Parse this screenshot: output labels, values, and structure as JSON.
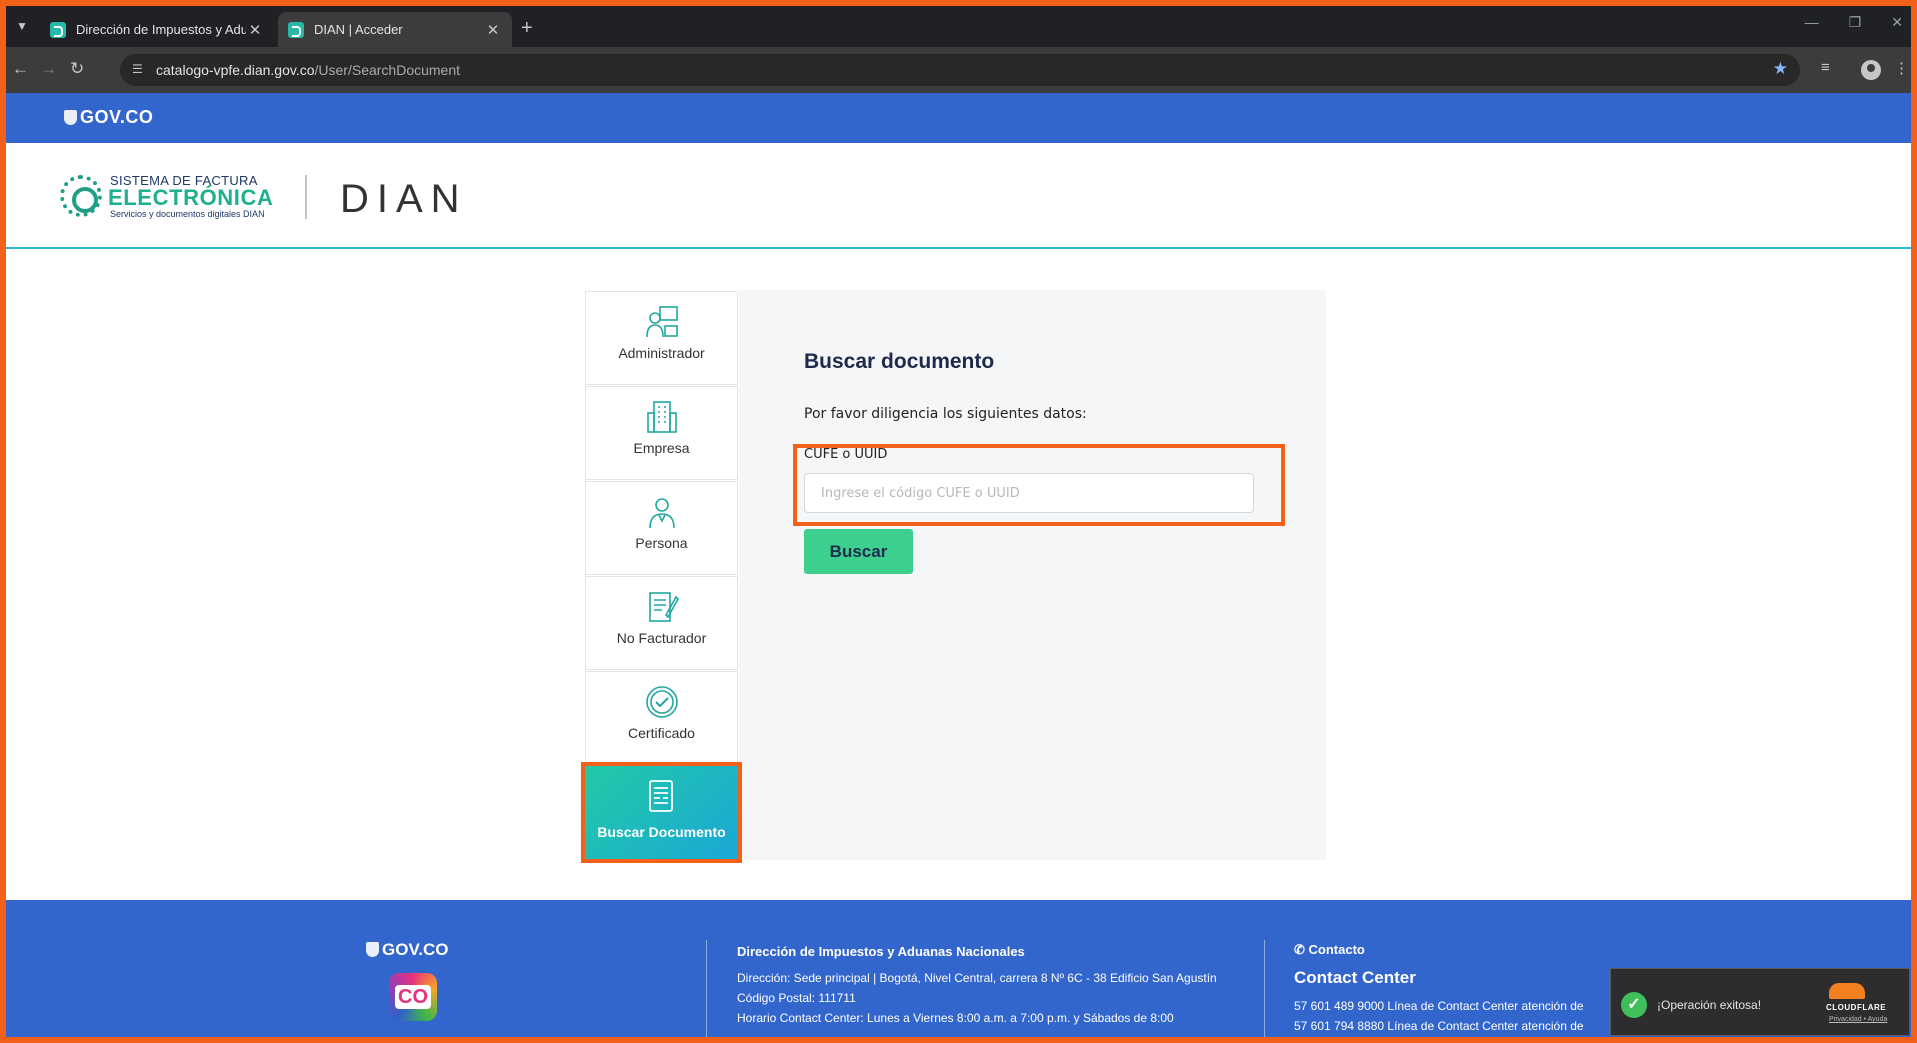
{
  "browser": {
    "tabs": [
      {
        "title": "Dirección de Impuestos y Adua",
        "active": false
      },
      {
        "title": "DIAN | Acceder",
        "active": true
      }
    ],
    "new_tab_icon": "plus",
    "url_host": "catalogo-vpfe.dian.gov.co",
    "url_path": "/User/SearchDocument"
  },
  "gov_bar": {
    "logo": "GOV.CO"
  },
  "brand": {
    "sfe_line1": "SISTEMA DE FACTURA",
    "sfe_line2": "ELECTRÓNICA",
    "sfe_line3": "Servicios y documentos digitales DIAN",
    "dian": "DIAN"
  },
  "menu": [
    {
      "label": "Administrador",
      "icon": "admin-icon"
    },
    {
      "label": "Empresa",
      "icon": "building-icon"
    },
    {
      "label": "Persona",
      "icon": "person-icon"
    },
    {
      "label": "No Facturador",
      "icon": "document-edit-icon"
    },
    {
      "label": "Certificado",
      "icon": "certificate-icon"
    },
    {
      "label": "Buscar Documento",
      "icon": "document-search-icon",
      "active": true
    }
  ],
  "form": {
    "title": "Buscar documento",
    "instructions": "Por favor diligencia los siguientes datos:",
    "field_label": "CUFE o UUID",
    "placeholder": "Ingrese el código CUFE o UUID",
    "value": "",
    "button": "Buscar"
  },
  "footer": {
    "gov": "GOV.CO",
    "co_badge": "CO",
    "entity": "Dirección de Impuestos y Aduanas Nacionales",
    "address": "Dirección: Sede principal | Bogotá, Nivel Central, carrera 8 Nº 6C - 38 Edificio San Agustín",
    "postal": "Código Postal: 111711",
    "hours": "Horario Contact Center: Lunes a Viernes 8:00 a.m. a 7:00 p.m. y Sábados de 8:00",
    "contact_head": "Contacto",
    "contact_center": "Contact Center",
    "phone1": "57 601 489 9000 Línea de Contact Center atención de",
    "phone2": "57 601 794 8880 Línea de Contact Center atención de"
  },
  "toast": {
    "message": "¡Operación exitosa!",
    "provider": "CLOUDFLARE",
    "links": "Privacidad • Ayuda"
  },
  "colors": {
    "gov_blue": "#3366cc",
    "accent_green": "#3ccf8e",
    "annotation_orange": "#f36019",
    "active_gradient_start": "#23c9a6",
    "active_gradient_end": "#1aa8d6"
  }
}
